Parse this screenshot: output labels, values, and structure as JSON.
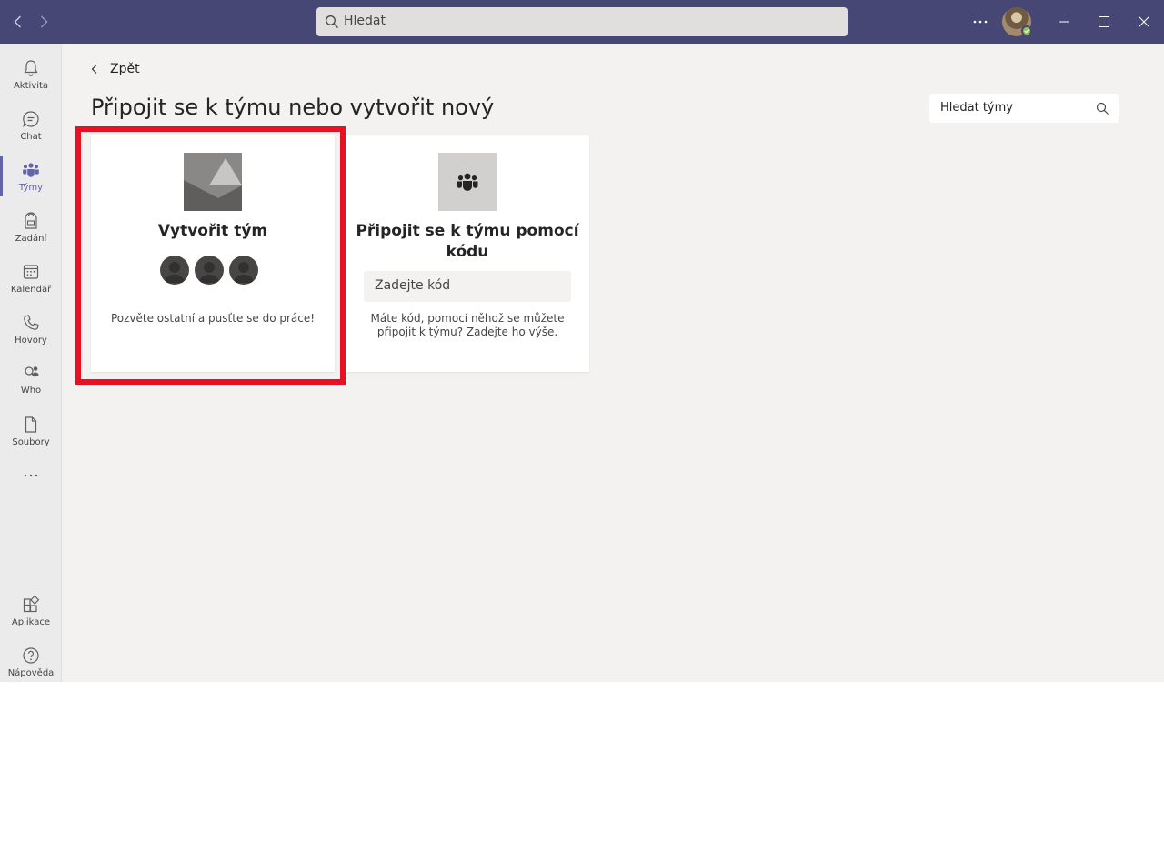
{
  "titlebar": {
    "search_text": "Hledat"
  },
  "rail": {
    "items": [
      {
        "label": "Aktivita",
        "icon": "bell-icon"
      },
      {
        "label": "Chat",
        "icon": "chat-icon"
      },
      {
        "label": "Týmy",
        "icon": "teams-icon",
        "active": true
      },
      {
        "label": "Zadání",
        "icon": "assignments-icon"
      },
      {
        "label": "Kalendář",
        "icon": "calendar-icon"
      },
      {
        "label": "Hovory",
        "icon": "phone-icon"
      },
      {
        "label": "Who",
        "icon": "who-icon"
      },
      {
        "label": "Soubory",
        "icon": "file-icon"
      }
    ],
    "bottom_items": [
      {
        "label": "Aplikace",
        "icon": "apps-icon"
      },
      {
        "label": "Nápověda",
        "icon": "help-icon"
      }
    ]
  },
  "page": {
    "back_label": "Zpět",
    "title": "Připojit se k týmu nebo vytvořit nový",
    "team_search_placeholder": "Hledat týmy"
  },
  "cards": {
    "create": {
      "title": "Vytvořit tým",
      "description": "Pozvěte ostatní a pusťte se do práce!"
    },
    "join": {
      "title_line1": "Připojit se k týmu pomocí",
      "title_line2": "kódu",
      "code_placeholder": "Zadejte kód",
      "description_line1": "Máte kód, pomocí něhož se můžete",
      "description_line2": "připojit k týmu? Zadejte ho výše."
    }
  },
  "colors": {
    "titlebar": "#464775",
    "accent": "#6264a7",
    "highlight": "#e81123",
    "presence": "#92c353"
  }
}
